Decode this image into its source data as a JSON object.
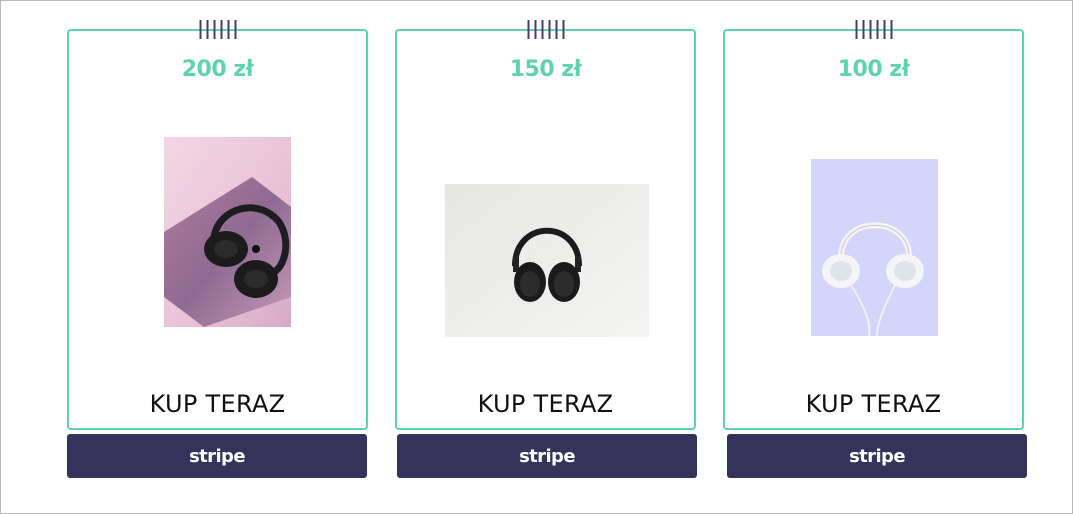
{
  "products": [
    {
      "price": "200 zł",
      "cta": "KUP TERAZ",
      "button": "stripe",
      "image": "headphones-on-laptop"
    },
    {
      "price": "150 zł",
      "cta": "KUP TERAZ",
      "button": "stripe",
      "image": "black-headphones"
    },
    {
      "price": "100 zł",
      "cta": "KUP TERAZ",
      "button": "stripe",
      "image": "white-headphones"
    }
  ],
  "colors": {
    "accent": "#5fd3ae",
    "button": "#35325c",
    "ticks": "#4a3c6b"
  }
}
